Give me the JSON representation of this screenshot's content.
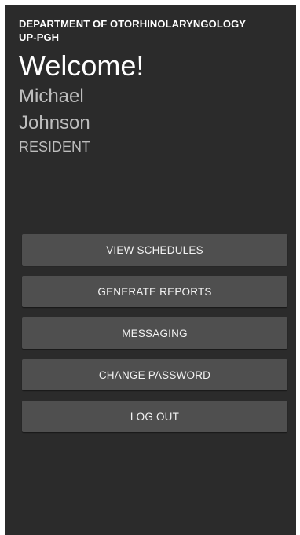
{
  "header": {
    "department_line1": "DEPARTMENT OF OTORHINOLARYNGOLOGY",
    "department_line2": "UP-PGH",
    "welcome": "Welcome!",
    "first_name": "Michael",
    "last_name": "Johnson",
    "role": "RESIDENT"
  },
  "menu": {
    "buttons": [
      {
        "label": "VIEW SCHEDULES"
      },
      {
        "label": "GENERATE REPORTS"
      },
      {
        "label": "MESSAGING"
      },
      {
        "label": "CHANGE PASSWORD"
      },
      {
        "label": "LOG OUT"
      }
    ]
  },
  "colors": {
    "background": "#2b2b2b",
    "button": "#4f4f4f",
    "secondary_text": "#bdbdbd"
  }
}
